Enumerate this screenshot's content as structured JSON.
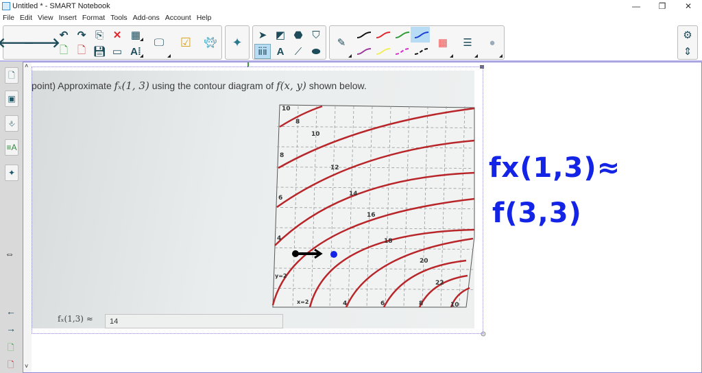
{
  "window": {
    "title": "Untitled * - SMART Notebook",
    "minimize": "—",
    "restore": "❐",
    "close": "✕"
  },
  "menu": [
    "File",
    "Edit",
    "View",
    "Insert",
    "Format",
    "Tools",
    "Add-ons",
    "Account",
    "Help"
  ],
  "toolbar": {
    "back": "🡐",
    "forward": "🡒",
    "undo": "↶",
    "redo": "↷",
    "delete": "✕",
    "text": "A",
    "pens": [
      {
        "color": "#111111"
      },
      {
        "color": "#e0262b"
      },
      {
        "color": "#2e9c35"
      },
      {
        "color": "#1b3fd6"
      },
      {
        "color": "#9c3a9c"
      },
      {
        "color": "#f0ef5a"
      },
      {
        "color": "#e02bd6"
      },
      {
        "color": "#111111"
      }
    ]
  },
  "content": {
    "question_prefix": "point) Approximate",
    "question_fx": "fₓ(1, 3)",
    "question_mid": "using the contour diagram of",
    "question_f": "f(x, y)",
    "question_suffix": "shown below.",
    "answer_label": "fₓ(1,3) ≈",
    "answer_value": "14",
    "contour_labels": {
      "l10a": "10",
      "l8a": "8",
      "l10b": "10",
      "l8b": "8",
      "l12": "12",
      "l6": "6",
      "l14": "14",
      "l16": "16",
      "l4": "4",
      "l18": "18",
      "y2": "y=2",
      "l20": "20",
      "l22": "22",
      "x2": "x=2",
      "b4": "4",
      "b6": "6",
      "b8": "8",
      "b10": "10"
    }
  },
  "handwriting": {
    "line1": "fx(1,3)≈",
    "line2": "f(3,3)"
  },
  "colors": {
    "accent": "#8d87d6",
    "contour": "#b8262a",
    "ink": "#1424e6"
  }
}
